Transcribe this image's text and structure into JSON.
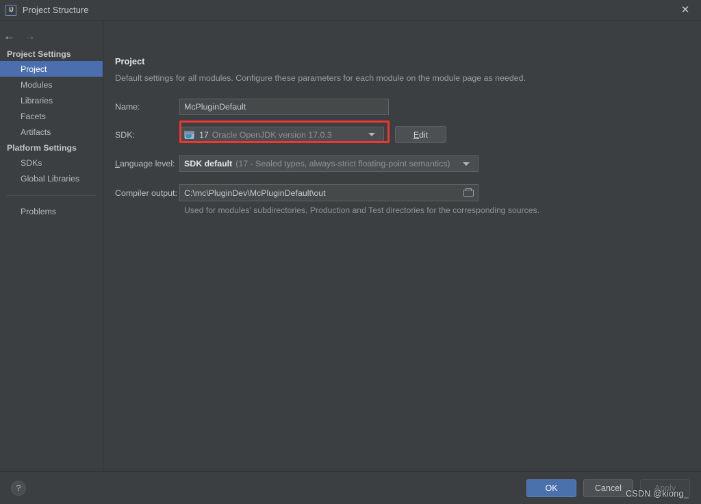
{
  "window": {
    "title": "Project Structure",
    "app_icon": "intellij-idea-icon",
    "close_icon": "close-icon"
  },
  "nav": {
    "back_icon": "arrow-left-icon",
    "forward_icon": "arrow-right-icon"
  },
  "sidebar": {
    "groups": [
      {
        "title": "Project Settings",
        "items": [
          {
            "label": "Project",
            "selected": true
          },
          {
            "label": "Modules",
            "selected": false
          },
          {
            "label": "Libraries",
            "selected": false
          },
          {
            "label": "Facets",
            "selected": false
          },
          {
            "label": "Artifacts",
            "selected": false
          }
        ]
      },
      {
        "title": "Platform Settings",
        "items": [
          {
            "label": "SDKs",
            "selected": false
          },
          {
            "label": "Global Libraries",
            "selected": false
          }
        ]
      }
    ],
    "extra": {
      "label": "Problems"
    }
  },
  "main": {
    "title": "Project",
    "description": "Default settings for all modules. Configure these parameters for each module on the module page as needed.",
    "name": {
      "label": "Name:",
      "value": "McPluginDefault"
    },
    "sdk": {
      "label": "SDK:",
      "icon": "java-sdk-folder-icon",
      "version": "17",
      "detail": "Oracle OpenJDK version 17.0.3",
      "caret_icon": "chevron-down-icon",
      "edit_button": "Edit",
      "edit_mnemonic": "E",
      "highlight_color": "#f1362f"
    },
    "language_level": {
      "label": "Language level:",
      "label_mnemonic": "L",
      "value": "SDK default",
      "detail": "(17 - Sealed types, always-strict floating-point semantics)",
      "caret_icon": "chevron-down-icon"
    },
    "compiler_output": {
      "label": "Compiler output:",
      "value": "C:\\mc\\PluginDev\\McPluginDefault\\out",
      "browse_icon": "folder-open-icon",
      "hint": "Used for modules' subdirectories, Production and Test directories for the corresponding sources."
    }
  },
  "footer": {
    "help_icon": "question-mark-icon",
    "ok": "OK",
    "cancel": "Cancel",
    "apply": "Apply",
    "ok_color": "#4a71ab"
  },
  "watermark": {
    "text": "CSDN @kiong_"
  }
}
